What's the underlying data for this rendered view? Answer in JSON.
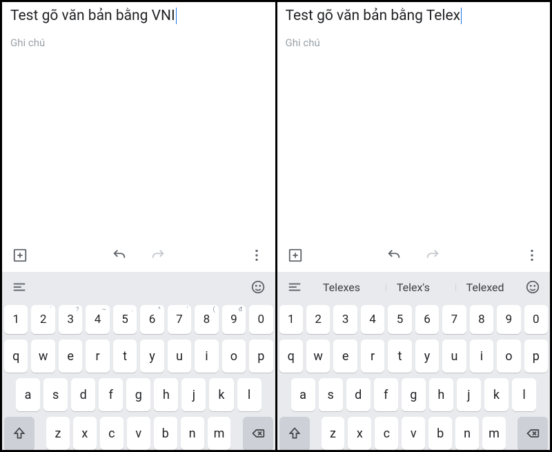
{
  "panes": {
    "left": {
      "title": "Test gõ văn bản bằng VNI",
      "subtitle": "Ghi chú",
      "suggestions": []
    },
    "right": {
      "title": "Test gõ văn bản bằng Telex",
      "subtitle": "Ghi chú",
      "suggestions": [
        "Telexes",
        "Telex's",
        "Telexed"
      ]
    }
  },
  "digit_hints": {
    "left": {
      "2": "`",
      "3": "?",
      "4": "~",
      "5": ".",
      "6": "^",
      "7": "'",
      "8": "(",
      "9": "đ"
    },
    "right": {}
  },
  "keyboard": {
    "row_digits": [
      "1",
      "2",
      "3",
      "4",
      "5",
      "6",
      "7",
      "8",
      "9",
      "0"
    ],
    "row_q": [
      "q",
      "w",
      "e",
      "r",
      "t",
      "y",
      "u",
      "i",
      "o",
      "p"
    ],
    "row_a": [
      "a",
      "s",
      "d",
      "f",
      "g",
      "h",
      "j",
      "k",
      "l"
    ],
    "row_z": [
      "z",
      "x",
      "c",
      "v",
      "b",
      "n",
      "m"
    ]
  }
}
